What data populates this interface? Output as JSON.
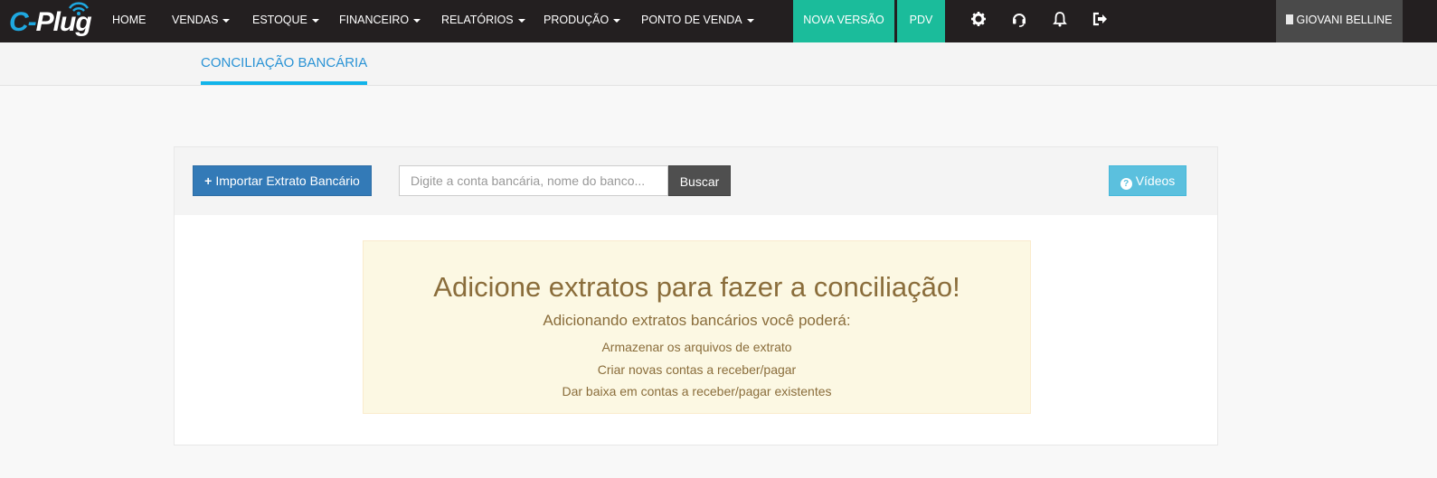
{
  "navbar": {
    "logo_text": "C-Plug",
    "items": [
      {
        "label": "HOME",
        "dropdown": false
      },
      {
        "label": "VENDAS",
        "dropdown": true
      },
      {
        "label": "ESTOQUE",
        "dropdown": true
      },
      {
        "label": "FINANCEIRO",
        "dropdown": true
      },
      {
        "label": "RELATÓRIOS",
        "dropdown": true
      },
      {
        "label": "PRODUÇÃO",
        "dropdown": true
      },
      {
        "label": "PONTO DE VENDA",
        "dropdown": true
      }
    ],
    "nova_versao": "NOVA VERSÃO",
    "pdv": "PDV",
    "icons": [
      "gear-icon",
      "headset-icon",
      "bell-icon",
      "logout-icon"
    ],
    "user": "GIOVANI BELLINE",
    "accent_green": "#1bbc9b"
  },
  "tabs": {
    "active": "CONCILIAÇÃO BANCÁRIA"
  },
  "toolbar": {
    "import_label": "Importar Extrato Bancário",
    "search_placeholder": "Digite a conta bancária, nome do banco...",
    "search_button": "Buscar",
    "videos_label": "Vídeos"
  },
  "alert": {
    "title": "Adicione extratos para fazer a conciliação!",
    "subtitle": "Adicionando extratos bancários você poderá:",
    "lines": [
      "Armazenar os arquivos de extrato",
      "Criar novas contas a receber/pagar",
      "Dar baixa em contas a receber/pagar existentes"
    ]
  }
}
